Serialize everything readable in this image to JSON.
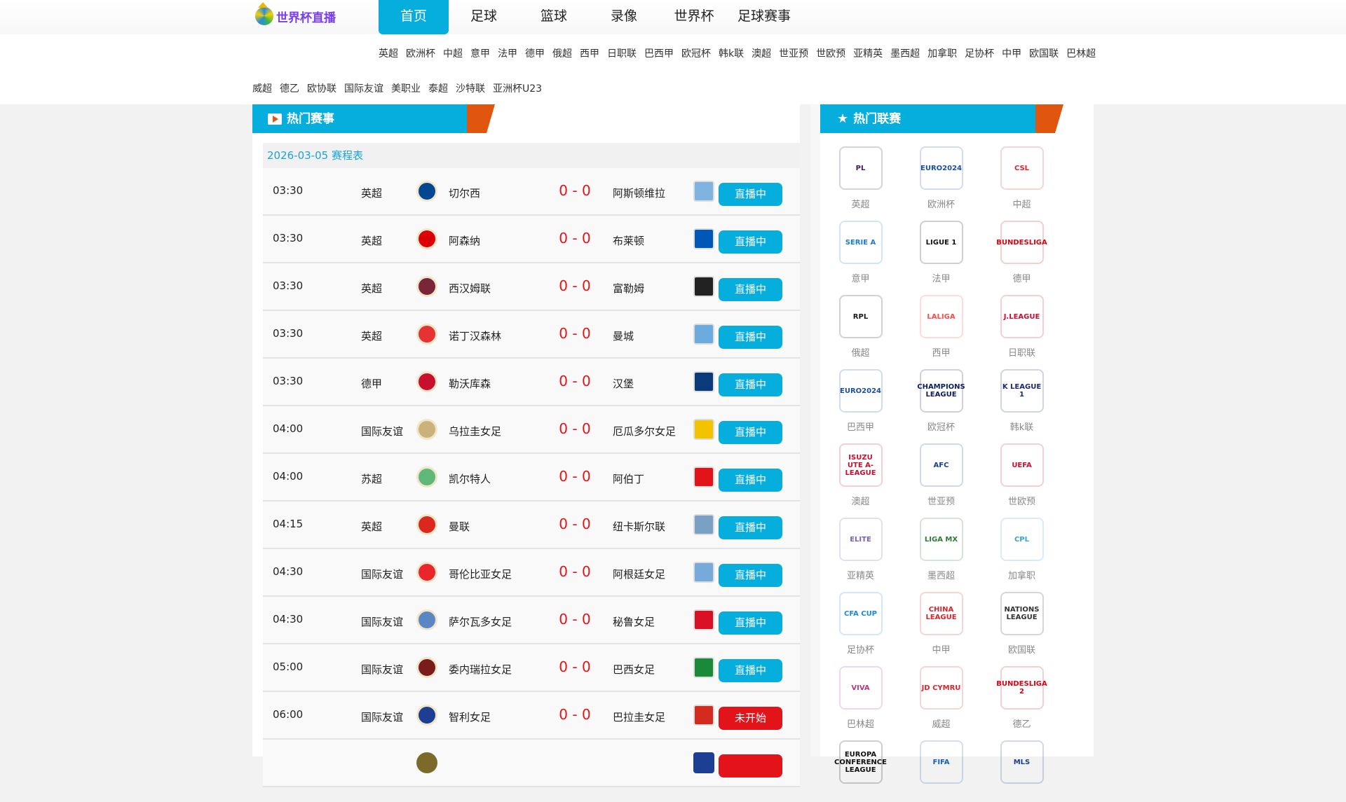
{
  "site": {
    "name": "世界杯直播"
  },
  "nav": [
    "首页",
    "足球",
    "篮球",
    "录像",
    "世界杯",
    "足球赛事"
  ],
  "subnav_row1": [
    "英超",
    "欧洲杯",
    "中超",
    "意甲",
    "法甲",
    "德甲",
    "俄超",
    "西甲",
    "日职联",
    "巴西甲",
    "欧冠杯",
    "韩k联",
    "澳超",
    "世亚预",
    "世欧预",
    "亚精英",
    "墨西超",
    "加拿职",
    "足协杯",
    "中甲",
    "欧国联",
    "巴林超"
  ],
  "subnav_row2": [
    "威超",
    "德乙",
    "欧协联",
    "国际友谊",
    "美职业",
    "泰超",
    "沙特联",
    "亚洲杯U23"
  ],
  "schedule": {
    "title": "热门赛事",
    "date": "2026-03-05 赛程表",
    "matches": [
      {
        "time": "03:30",
        "league": "英超",
        "home": "切尔西",
        "score": "0 - 0",
        "away": "阿斯顿维拉",
        "status": "直播中",
        "hc": "#034694",
        "ac": "#7fb3df"
      },
      {
        "time": "03:30",
        "league": "英超",
        "home": "阿森纳",
        "score": "0 - 0",
        "away": "布莱顿",
        "status": "直播中",
        "hc": "#db0007",
        "ac": "#0057b8"
      },
      {
        "time": "03:30",
        "league": "英超",
        "home": "西汉姆联",
        "score": "0 - 0",
        "away": "富勒姆",
        "status": "直播中",
        "hc": "#7a263a",
        "ac": "#222222"
      },
      {
        "time": "03:30",
        "league": "英超",
        "home": "诺丁汉森林",
        "score": "0 - 0",
        "away": "曼城",
        "status": "直播中",
        "hc": "#e53233",
        "ac": "#6cabdd"
      },
      {
        "time": "03:30",
        "league": "德甲",
        "home": "勒沃库森",
        "score": "0 - 0",
        "away": "汉堡",
        "status": "直播中",
        "hc": "#c8102e",
        "ac": "#0a3a7a"
      },
      {
        "time": "04:00",
        "league": "国际友谊",
        "home": "乌拉圭女足",
        "score": "0 - 0",
        "away": "厄瓜多尔女足",
        "status": "直播中",
        "hc": "#c9b27c",
        "ac": "#f4c300"
      },
      {
        "time": "04:00",
        "league": "苏超",
        "home": "凯尔特人",
        "score": "0 - 0",
        "away": "阿伯丁",
        "status": "直播中",
        "hc": "#5fb87a",
        "ac": "#e2141a"
      },
      {
        "time": "04:15",
        "league": "英超",
        "home": "曼联",
        "score": "0 - 0",
        "away": "纽卡斯尔联",
        "status": "直播中",
        "hc": "#da291c",
        "ac": "#7aa0c4"
      },
      {
        "time": "04:30",
        "league": "国际友谊",
        "home": "哥伦比亚女足",
        "score": "0 - 0",
        "away": "阿根廷女足",
        "status": "直播中",
        "hc": "#e8262c",
        "ac": "#75aadb"
      },
      {
        "time": "04:30",
        "league": "国际友谊",
        "home": "萨尔瓦多女足",
        "score": "0 - 0",
        "away": "秘鲁女足",
        "status": "直播中",
        "hc": "#5b86c4",
        "ac": "#d91023"
      },
      {
        "time": "05:00",
        "league": "国际友谊",
        "home": "委内瑞拉女足",
        "score": "0 - 0",
        "away": "巴西女足",
        "status": "直播中",
        "hc": "#7b1c1c",
        "ac": "#1a8a3a"
      },
      {
        "time": "06:00",
        "league": "国际友谊",
        "home": "智利女足",
        "score": "0 - 0",
        "away": "巴拉圭女足",
        "status": "未开始",
        "hc": "#1c3f94",
        "ac": "#d52b1e"
      }
    ]
  },
  "leagues": {
    "title": "热门联赛",
    "items": [
      {
        "label": "英超",
        "mark": "PL",
        "c": "#3d195b"
      },
      {
        "label": "欧洲杯",
        "mark": "EURO2024",
        "c": "#1d4e9e"
      },
      {
        "label": "中超",
        "mark": "CSL",
        "c": "#d8262b"
      },
      {
        "label": "意甲",
        "mark": "SERIE A",
        "c": "#1b7bd0"
      },
      {
        "label": "法甲",
        "mark": "LIGUE 1",
        "c": "#111111"
      },
      {
        "label": "德甲",
        "mark": "BUNDESLIGA",
        "c": "#d20515"
      },
      {
        "label": "俄超",
        "mark": "RPL",
        "c": "#1a1a1a"
      },
      {
        "label": "西甲",
        "mark": "LALIGA",
        "c": "#ff4b44"
      },
      {
        "label": "日职联",
        "mark": "J.LEAGUE",
        "c": "#c8102e"
      },
      {
        "label": "巴西甲",
        "mark": "EURO2024",
        "c": "#1d4e9e"
      },
      {
        "label": "欧冠杯",
        "mark": "CHAMPIONS LEAGUE",
        "c": "#0e1e5b"
      },
      {
        "label": "韩k联",
        "mark": "K LEAGUE 1",
        "c": "#1b2a6b"
      },
      {
        "label": "澳超",
        "mark": "ISUZU UTE A-LEAGUE",
        "c": "#c8102e"
      },
      {
        "label": "世亚预",
        "mark": "AFC",
        "c": "#1b3f8f"
      },
      {
        "label": "世欧预",
        "mark": "UEFA",
        "c": "#c8102e"
      },
      {
        "label": "亚精英",
        "mark": "ELITE",
        "c": "#7a5fb0"
      },
      {
        "label": "墨西超",
        "mark": "LIGA MX",
        "c": "#2d7a3a"
      },
      {
        "label": "加拿职",
        "mark": "CPL",
        "c": "#3aa0d8"
      },
      {
        "label": "足协杯",
        "mark": "CFA CUP",
        "c": "#1b8ad0"
      },
      {
        "label": "中甲",
        "mark": "CHINA LEAGUE",
        "c": "#d8262b"
      },
      {
        "label": "欧国联",
        "mark": "NATIONS LEAGUE",
        "c": "#333333"
      },
      {
        "label": "巴林超",
        "mark": "VIVA",
        "c": "#b23a8a"
      },
      {
        "label": "威超",
        "mark": "JD CYMRU",
        "c": "#d8262b"
      },
      {
        "label": "德乙",
        "mark": "BUNDESLIGA 2",
        "c": "#d20515"
      },
      {
        "label": "",
        "mark": "EUROPA CONFERENCE LEAGUE",
        "c": "#111111"
      },
      {
        "label": "",
        "mark": "FIFA",
        "c": "#1b5fb0"
      },
      {
        "label": "",
        "mark": "MLS",
        "c": "#1b3f8f"
      }
    ]
  },
  "colors": {
    "accent": "#06aede",
    "orange": "#e0560f",
    "score": "#e2141a"
  }
}
